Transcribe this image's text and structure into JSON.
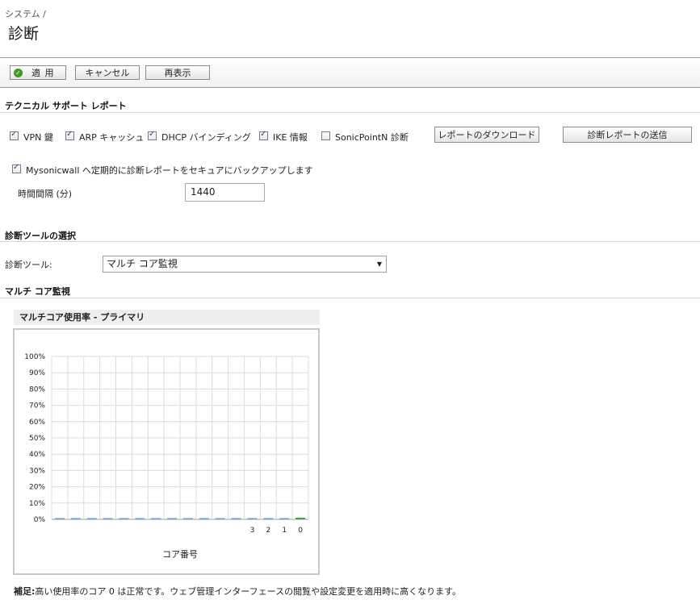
{
  "breadcrumb": "システム /",
  "page_title": "診断",
  "toolbar": {
    "apply_label": "適 用",
    "cancel_label": "キャンセル",
    "refresh_label": "再表示"
  },
  "tech_support": {
    "title": "テクニカル サポート レポート",
    "options": [
      {
        "label": "VPN 鍵",
        "checked": true
      },
      {
        "label": "ARP キャッシュ",
        "checked": true
      },
      {
        "label": "DHCP バインディング",
        "checked": true
      },
      {
        "label": "IKE 情報",
        "checked": true
      },
      {
        "label": "SonicPointN 診断",
        "checked": false
      }
    ],
    "download_label": "レポートのダウンロード",
    "send_label": "診断レポートの送信",
    "backup_label": "Mysonicwall へ定期的に診断レポートをセキュアにバックアップします",
    "backup_checked": true,
    "interval_label": "時間間隔 (分)",
    "interval_value": "1440"
  },
  "tool_select": {
    "title": "診断ツールの選択",
    "label": "診断ツール:",
    "selected": "マルチ コア監視"
  },
  "multicore": {
    "title": "マルチ コア監視",
    "chart_title": "マルチコア使用率 - プライマリ"
  },
  "chart_data": {
    "type": "bar",
    "title": "マルチコア使用率 - プライマリ",
    "xlabel": "コア番号",
    "ylabel": "",
    "ylim": [
      0,
      100
    ],
    "yticks": [
      "100%",
      "90%",
      "80%",
      "70%",
      "60%",
      "50%",
      "40%",
      "30%",
      "20%",
      "10%",
      "0%"
    ],
    "categories": [
      "",
      "",
      "",
      "",
      "",
      "",
      "",
      "",
      "",
      "",
      "",
      "",
      "3",
      "2",
      "1",
      "0"
    ],
    "values": [
      0,
      0,
      0,
      0,
      0,
      0,
      0,
      0,
      0,
      0,
      0,
      0,
      0,
      0,
      0,
      1
    ],
    "colors": {
      "normal": "#6b9fd6",
      "core0": "#3fa63f"
    }
  },
  "footer": {
    "note_label": "補足:",
    "note_text": "高い使用率のコア 0 は正常です。ウェブ管理インターフェースの閲覧や設定変更を適用時に高くなります。"
  }
}
